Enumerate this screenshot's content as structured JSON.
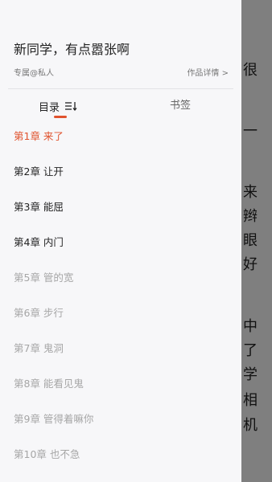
{
  "reader": {
    "visible_chars": [
      "很",
      "一",
      "来",
      "辫",
      "眼",
      "好",
      "中",
      "了",
      "学",
      "相",
      "机"
    ]
  },
  "drawer": {
    "book_title": "新同学，有点嚣张啊",
    "author": "专属@私人",
    "detail_link": "作品详情 >",
    "tabs": {
      "toc_label": "目录",
      "bookmark_label": "书签"
    },
    "chapters": [
      {
        "label": "第1章 来了",
        "state": "current"
      },
      {
        "label": "第2章 让开",
        "state": "unlocked"
      },
      {
        "label": "第3章 能屈",
        "state": "unlocked"
      },
      {
        "label": "第4章 内门",
        "state": "unlocked"
      },
      {
        "label": "第5章 管的宽",
        "state": "locked"
      },
      {
        "label": "第6章 步行",
        "state": "locked"
      },
      {
        "label": "第7章 鬼洞",
        "state": "locked"
      },
      {
        "label": "第8章 能看见鬼",
        "state": "locked"
      },
      {
        "label": "第9章 管得着嘛你",
        "state": "locked"
      },
      {
        "label": "第10章 也不急",
        "state": "locked"
      }
    ]
  },
  "colors": {
    "accent": "#e0532e",
    "drawer_bg": "#f7f7f9",
    "locked_text": "#a6a6a6"
  }
}
